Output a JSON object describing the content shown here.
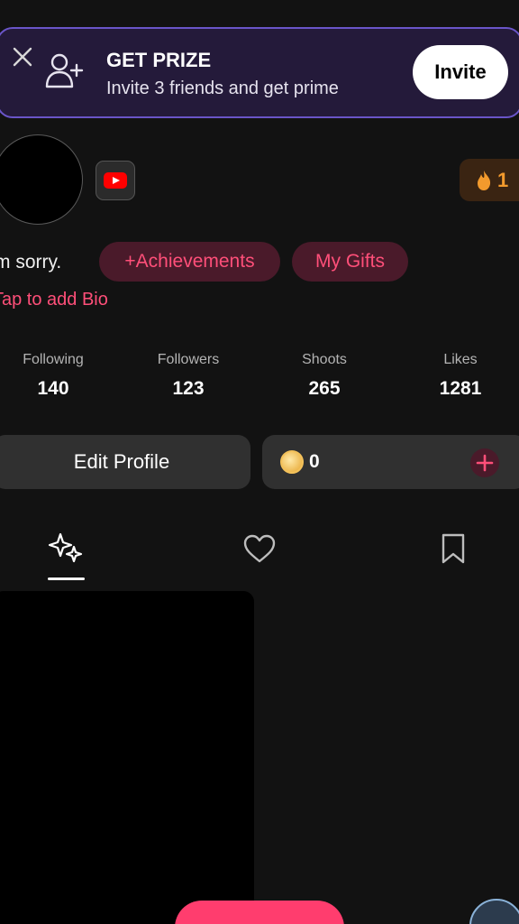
{
  "banner": {
    "title": "GET PRIZE",
    "subtitle": "Invite 3 friends and get prime",
    "invite_label": "Invite"
  },
  "profile": {
    "username": "m sorry.",
    "streak_count": "1",
    "achievements_label": "+Achievements",
    "gifts_label": "My Gifts",
    "bio_placeholder": "Tap to add Bio"
  },
  "stats": [
    {
      "label": "Following",
      "value": "140"
    },
    {
      "label": "Followers",
      "value": "123"
    },
    {
      "label": "Shoots",
      "value": "265"
    },
    {
      "label": "Likes",
      "value": "1281"
    }
  ],
  "actions": {
    "edit_profile_label": "Edit Profile",
    "coin_balance": "0"
  },
  "tabs": [
    "sparkles-icon",
    "heart-icon",
    "bookmark-icon"
  ],
  "colors": {
    "accent_pink": "#ff4f79",
    "banner_border": "#6a55c8",
    "streak_orange": "#f29a2d"
  }
}
